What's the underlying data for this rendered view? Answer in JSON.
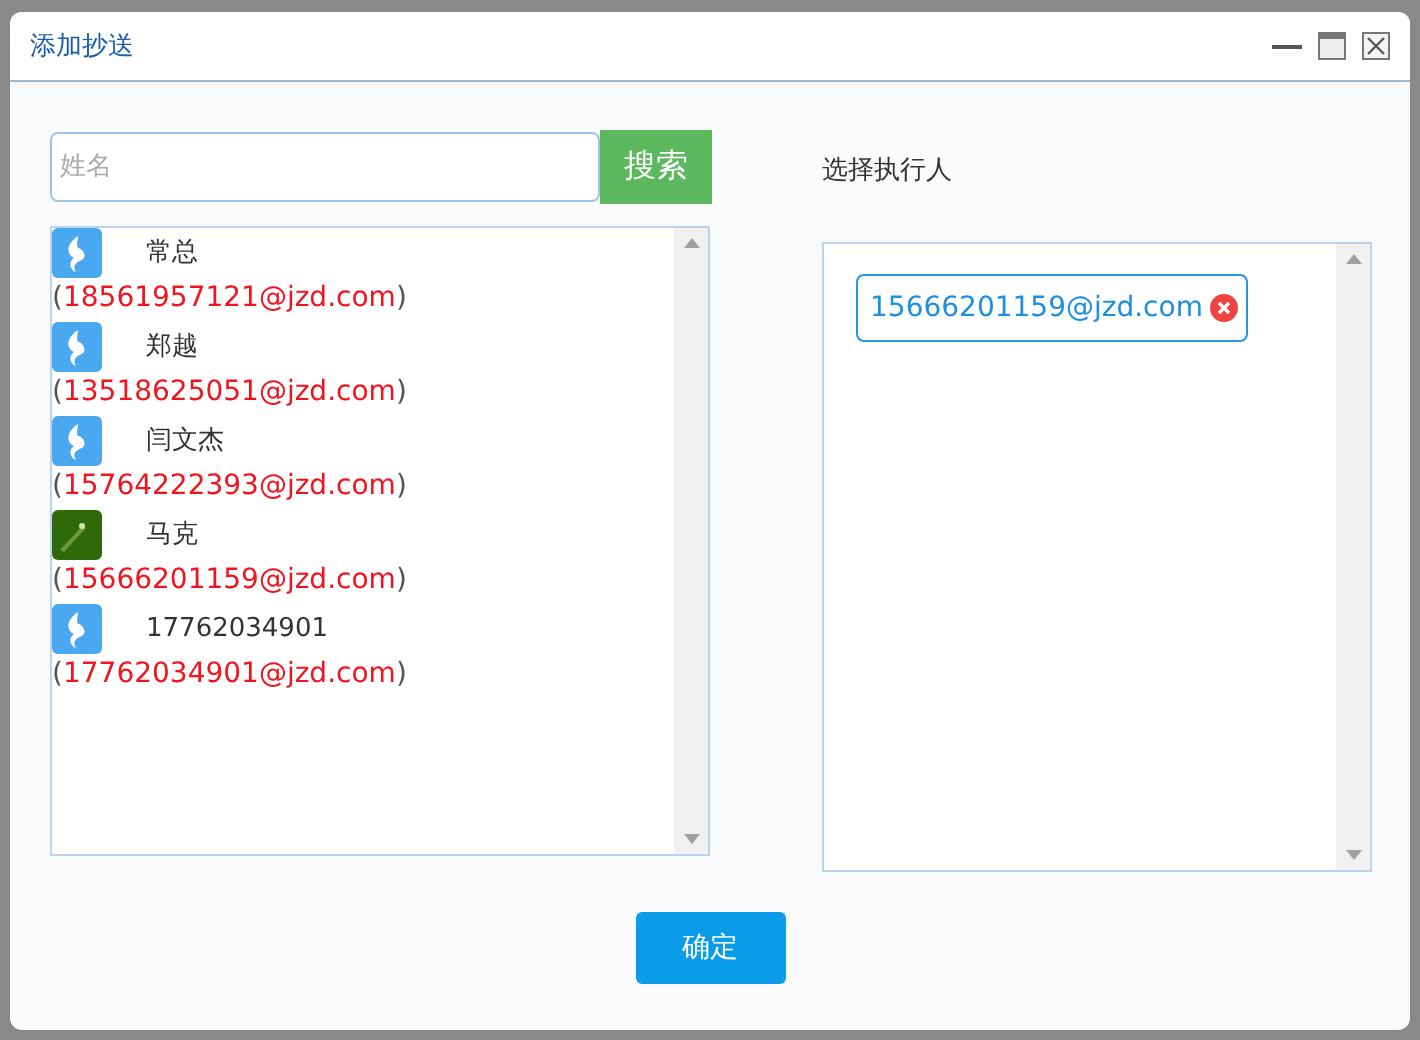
{
  "window": {
    "title": "添加抄送"
  },
  "search": {
    "placeholder": "姓名",
    "button": "搜索"
  },
  "contacts": [
    {
      "kind": "logo",
      "name": "常总",
      "prefix": "(",
      "email": "18561957121@jzd.com",
      "suffix": ")"
    },
    {
      "kind": "logo",
      "name": "郑越",
      "prefix": "(",
      "email": "13518625051@jzd.com",
      "suffix": ")"
    },
    {
      "kind": "logo",
      "name": "闫文杰",
      "prefix": "(",
      "email": "15764222393@jzd.com",
      "suffix": ")"
    },
    {
      "kind": "photo",
      "name": "马克",
      "prefix": "(",
      "email": "15666201159@jzd.com",
      "suffix": ")"
    },
    {
      "kind": "logo",
      "name": "17762034901",
      "prefix": "(",
      "email": "17762034901@jzd.com",
      "suffix": ")"
    }
  ],
  "selected_panel": {
    "label": "选择执行人",
    "tags": [
      "15666201159@jzd.com"
    ]
  },
  "confirm_button": "确定"
}
